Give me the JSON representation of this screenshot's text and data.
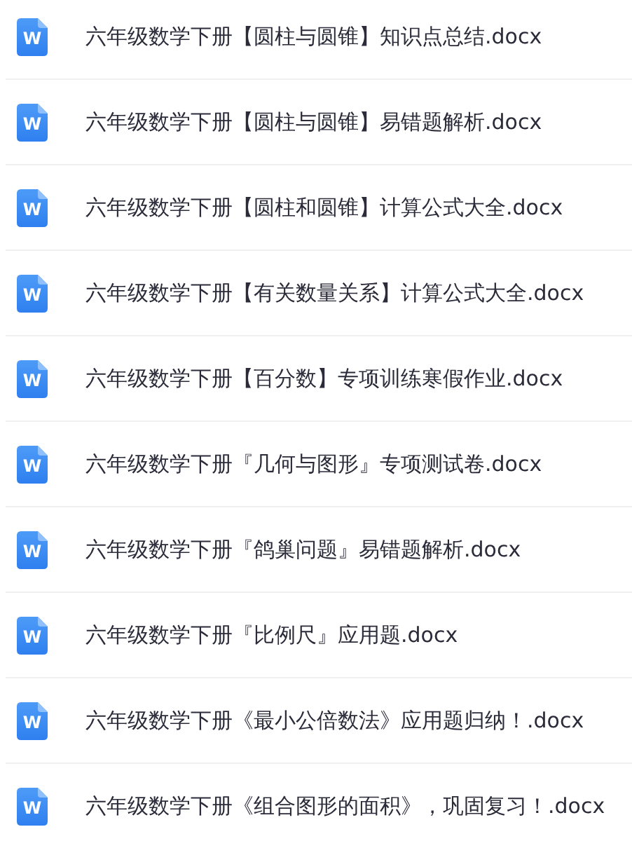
{
  "files": [
    {
      "name": "六年级数学下册【圆柱与圆锥】知识点总结.docx",
      "icon_letter": "W"
    },
    {
      "name": "六年级数学下册【圆柱与圆锥】易错题解析.docx",
      "icon_letter": "W"
    },
    {
      "name": "六年级数学下册【圆柱和圆锥】计算公式大全.docx",
      "icon_letter": "W"
    },
    {
      "name": "六年级数学下册【有关数量关系】计算公式大全.docx",
      "icon_letter": "W"
    },
    {
      "name": "六年级数学下册【百分数】专项训练寒假作业.docx",
      "icon_letter": "W"
    },
    {
      "name": "六年级数学下册『几何与图形』专项测试卷.docx",
      "icon_letter": "W"
    },
    {
      "name": "六年级数学下册『鸽巢问题』易错题解析.docx",
      "icon_letter": "W"
    },
    {
      "name": "六年级数学下册『比例尺』应用题.docx",
      "icon_letter": "W"
    },
    {
      "name": "六年级数学下册《最小公倍数法》应用题归纳！.docx",
      "icon_letter": "W"
    },
    {
      "name": "六年级数学下册《组合图形的面积》，巩固复习！.docx",
      "icon_letter": "W"
    }
  ]
}
